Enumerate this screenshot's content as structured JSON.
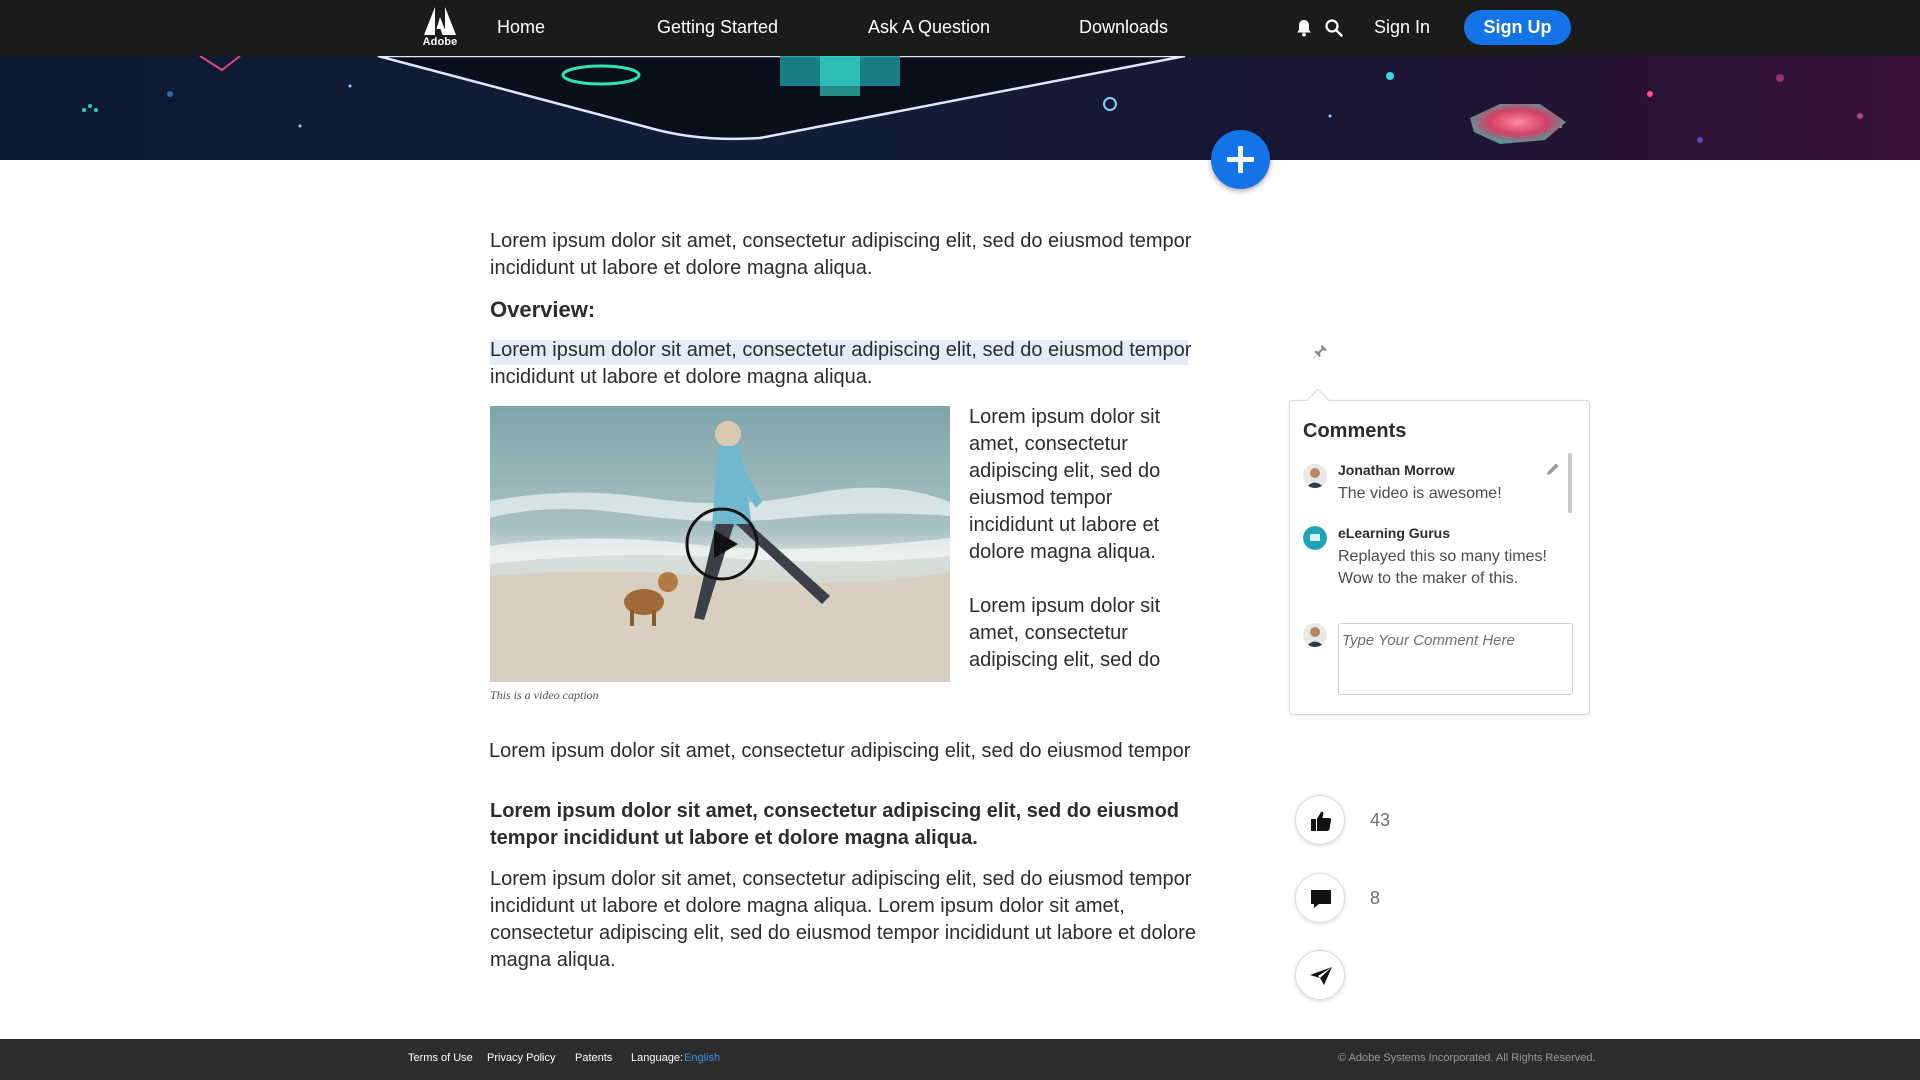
{
  "header": {
    "logo_text": "Adobe",
    "nav": [
      "Home",
      "Getting Started",
      "Ask A Question",
      "Downloads"
    ],
    "sign_in": "Sign In",
    "sign_up": "Sign Up"
  },
  "article": {
    "intro": "Lorem ipsum dolor sit amet, consectetur adipiscing elit, sed do eiusmod tempor incididunt ut labore et dolore magna aliqua.",
    "overview_heading": "Overview:",
    "overview_line1": "Lorem ipsum dolor sit amet, consectetur adipiscing elit, sed do eiusmod tempor",
    "overview_line2": "incididunt ut labore et dolore magna aliqua.",
    "side_text_1": "Lorem ipsum dolor sit amet, consectetur adipiscing elit, sed do eiusmod tempor incididunt ut labore et dolore magna aliqua.",
    "side_text_2": "Lorem ipsum dolor sit amet, consectetur adipiscing elit, sed do",
    "video_caption": "This is a video caption",
    "single_line": "Lorem ipsum dolor sit amet, consectetur adipiscing elit, sed do eiusmod tempor",
    "bold_paragraph": "Lorem ipsum dolor sit amet, consectetur adipiscing elit, sed do eiusmod tempor incididunt ut labore et dolore magna aliqua.",
    "closing_paragraph": "Lorem ipsum dolor sit amet, consectetur adipiscing elit, sed do eiusmod tempor incididunt ut labore et dolore magna aliqua. Lorem ipsum dolor sit amet, consectetur adipiscing elit, sed do eiusmod tempor incididunt ut labore et dolore magna aliqua."
  },
  "comments": {
    "title": "Comments",
    "items": [
      {
        "author": "Jonathan Morrow",
        "text": "The video is awesome!"
      },
      {
        "author": "eLearning Gurus",
        "text": "Replayed this so many times! Wow to the maker of this."
      }
    ],
    "input_placeholder": "Type Your Comment Here"
  },
  "actions": {
    "likes": "43",
    "comments": "8"
  },
  "footer": {
    "terms": "Terms of Use",
    "privacy": "Privacy Policy",
    "patents": "Patents",
    "language_label": "Language:",
    "language_value": "English",
    "copyright": "© Adobe Systems Incorporated. All Rights Reserved."
  },
  "icons": {
    "bell": "bell-icon",
    "search": "search-icon",
    "add": "plus-icon",
    "pin": "pin-icon",
    "edit": "pencil-icon",
    "play": "play-icon",
    "like": "thumbs-up-icon",
    "comment": "comment-bubble-icon",
    "share": "paper-plane-icon"
  },
  "colors": {
    "accent": "#1473e6",
    "nav_bg": "#1b1b1b",
    "footer_bg": "#2c2c2c",
    "highlight": "#e4ecf8"
  }
}
